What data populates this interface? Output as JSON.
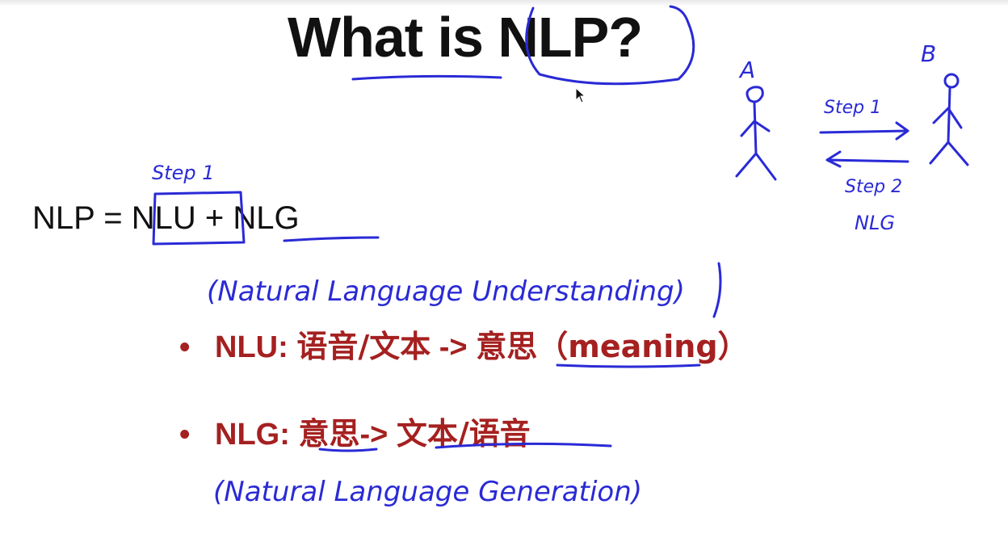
{
  "slide": {
    "title": "What is NLP?",
    "equation": {
      "lhs": "NLP =",
      "nlu": "NLU",
      "plus": "+",
      "nlg": "NLG"
    },
    "bullets": [
      {
        "marker": "•",
        "term": "NLU:",
        "input": "语音/文本",
        "arrow": "->",
        "output": "意思",
        "gloss": "（meaning）"
      },
      {
        "marker": "•",
        "term": "NLG:",
        "input": "意思",
        "arrow": "->",
        "output": "文本/语音"
      }
    ],
    "text_color": "#a52020",
    "title_color": "#111111"
  },
  "annotations": {
    "ink_color": "#2a2ad6",
    "step1_above_nlu": "Step 1",
    "nlu_expansion": "(Natural Language Understanding)",
    "nlg_expansion": "(Natural Language Generation)",
    "diagram": {
      "person_a": "A",
      "person_b": "B",
      "arrow_top": "Step 1",
      "arrow_bottom": "Step 2",
      "bottom_label": "NLG"
    }
  },
  "icons": {
    "cursor": "mouse-pointer-icon"
  }
}
